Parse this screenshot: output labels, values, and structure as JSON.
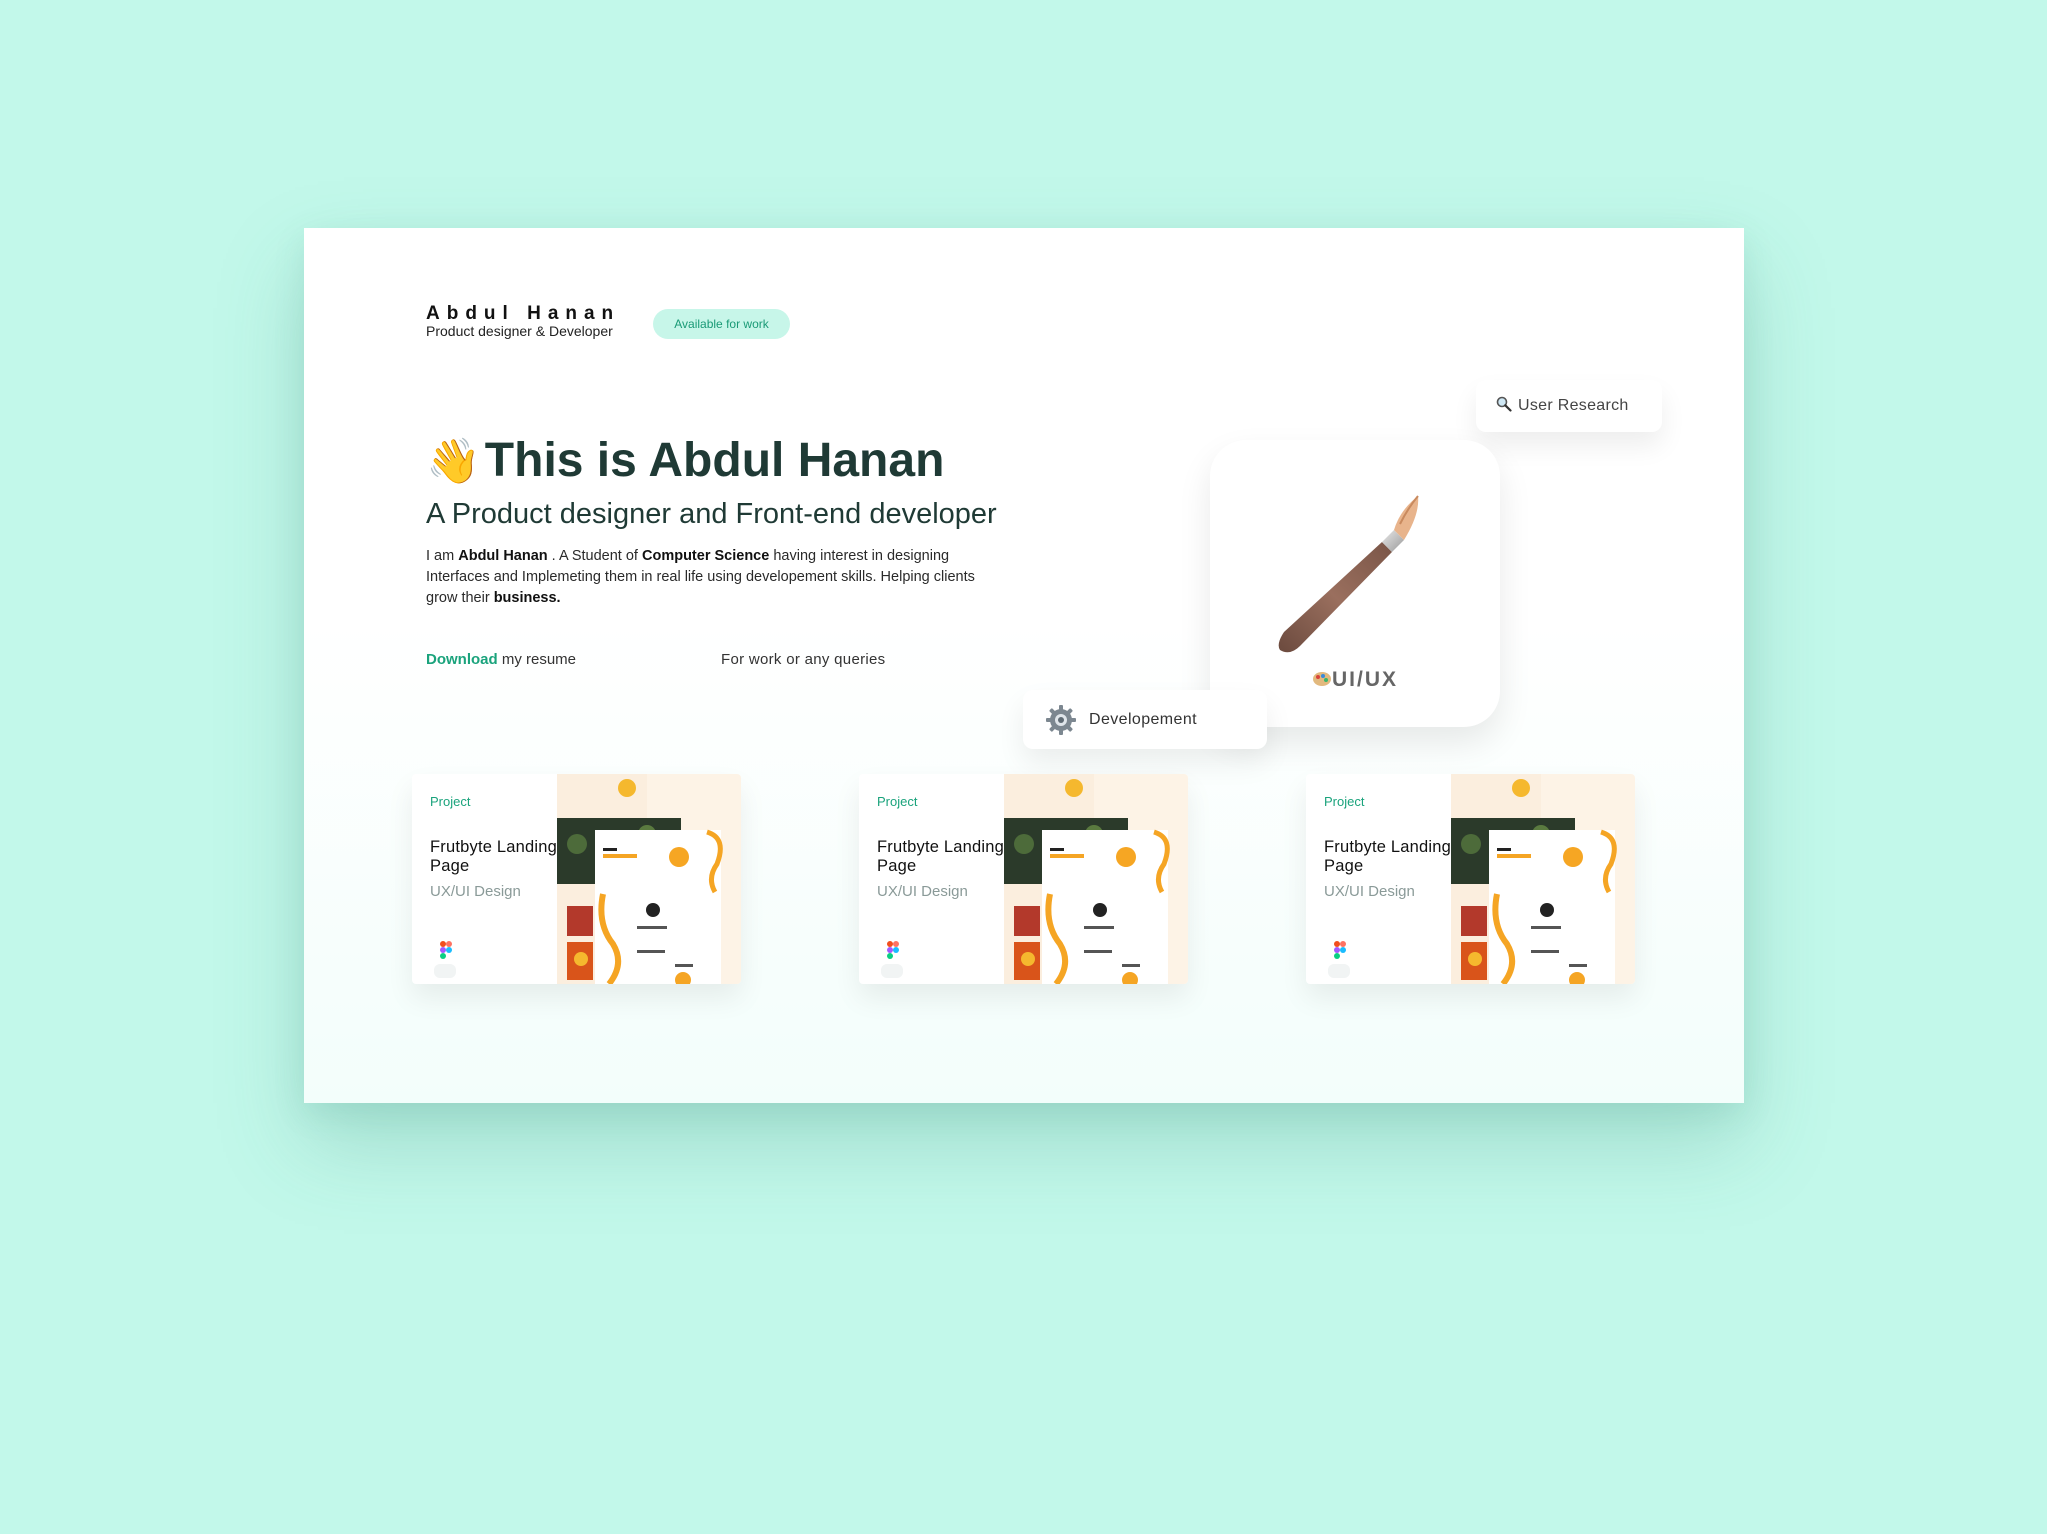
{
  "header": {
    "name": "Abdul Hanan",
    "role": "Product designer & Developer",
    "availability": "Available for work"
  },
  "hero": {
    "wave_emoji": "👋",
    "title": "This is Abdul Hanan",
    "subtitle": "A Product designer and Front-end developer",
    "desc": {
      "p1": "I am ",
      "name": "Abdul Hanan",
      "p2": " . A Student of ",
      "field": "Computer Science",
      "p3": " having interest in designing Interfaces and Implemeting them in real life using developement skills. Helping clients grow their ",
      "goal": "business."
    },
    "resume_link": "Download",
    "resume_rest": " my resume",
    "queries": "For work or any queries"
  },
  "skills": {
    "research": "User Research",
    "research_icon": "magnifier-icon",
    "uiux": "UI/UX",
    "uiux_icon": "paintbrush-icon",
    "dev": "Developement",
    "dev_icon": "gear-icon"
  },
  "projects": [
    {
      "tag": "Project",
      "title": "Frutbyte Landing Page",
      "type": "UX/UI Design",
      "tool_icon": "figma-icon"
    },
    {
      "tag": "Project",
      "title": "Frutbyte Landing Page",
      "type": "UX/UI Design",
      "tool_icon": "figma-icon"
    },
    {
      "tag": "Project",
      "title": "Frutbyte Landing Page",
      "type": "UX/UI Design",
      "tool_icon": "figma-icon"
    }
  ],
  "colors": {
    "background": "#c2f8ea",
    "accent": "#1aa37c",
    "heading": "#1f3a35",
    "badge_bg": "#c7f6e9",
    "fruit_orange": "#f5a524"
  }
}
